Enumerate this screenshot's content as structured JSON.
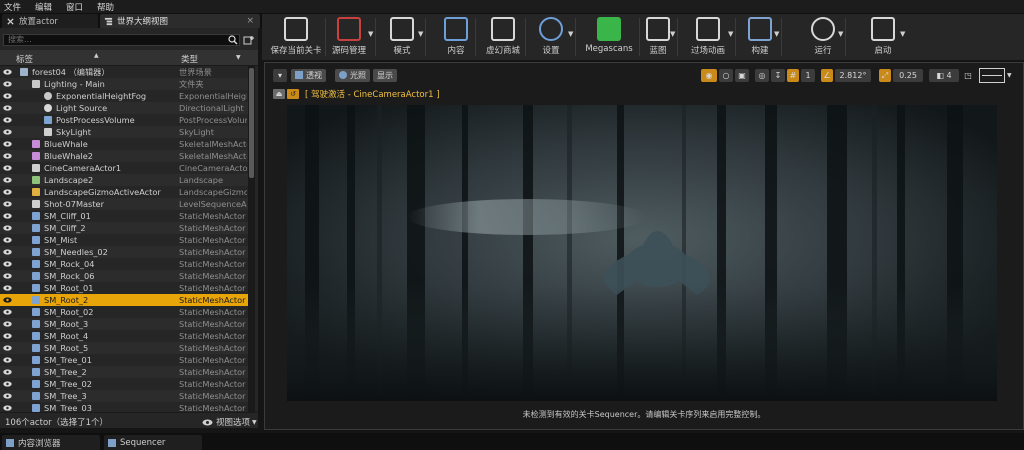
{
  "menu": [
    "文件",
    "编辑",
    "窗口",
    "帮助"
  ],
  "tabs": {
    "place_actor": "放置actor",
    "outliner": "世界大纲视图",
    "close_glyph": "×"
  },
  "outliner": {
    "search_placeholder": "搜索...",
    "col_label": "标签",
    "col_type": "类型",
    "rows": [
      {
        "label": "forest04 （编辑器）",
        "type": "世界场景",
        "icon": "world-icon"
      },
      {
        "label": "Lighting - Main",
        "type": "文件夹",
        "icon": "folder-icon"
      },
      {
        "label": "ExponentialHeightFog",
        "type": "ExponentialHeight",
        "icon": "fog-icon"
      },
      {
        "label": "Light Source",
        "type": "DirectionalLight",
        "icon": "sun-icon"
      },
      {
        "label": "PostProcessVolume",
        "type": "PostProcessVolum",
        "icon": "volume-icon"
      },
      {
        "label": "SkyLight",
        "type": "SkyLight",
        "icon": "skylight-icon"
      },
      {
        "label": "BlueWhale",
        "type": "SkeletalMeshActor",
        "icon": "skeletal-mesh-icon"
      },
      {
        "label": "BlueWhale2",
        "type": "SkeletalMeshActor",
        "icon": "skeletal-mesh-icon"
      },
      {
        "label": "CineCameraActor1",
        "type": "CineCameraActor",
        "icon": "camera-icon"
      },
      {
        "label": "Landscape2",
        "type": "Landscape",
        "icon": "landscape-icon"
      },
      {
        "label": "LandscapeGizmoActiveActor",
        "type": "LandscapeGizmoA",
        "icon": "gizmo-icon"
      },
      {
        "label": "Shot-07Master",
        "type": "LevelSequenceActo",
        "icon": "sequence-icon"
      },
      {
        "label": "SM_Cliff_01",
        "type": "StaticMeshActor",
        "icon": "static-mesh-icon"
      },
      {
        "label": "SM_Cliff_2",
        "type": "StaticMeshActor",
        "icon": "static-mesh-icon"
      },
      {
        "label": "SM_Mist",
        "type": "StaticMeshActor",
        "icon": "static-mesh-icon"
      },
      {
        "label": "SM_Needles_02",
        "type": "StaticMeshActor",
        "icon": "static-mesh-icon"
      },
      {
        "label": "SM_Rock_04",
        "type": "StaticMeshActor",
        "icon": "static-mesh-icon"
      },
      {
        "label": "SM_Rock_06",
        "type": "StaticMeshActor",
        "icon": "static-mesh-icon"
      },
      {
        "label": "SM_Root_01",
        "type": "StaticMeshActor",
        "icon": "static-mesh-icon"
      },
      {
        "label": "SM_Root_2",
        "type": "StaticMeshActor",
        "icon": "static-mesh-icon",
        "selected": true
      },
      {
        "label": "SM_Root_02",
        "type": "StaticMeshActor",
        "icon": "static-mesh-icon"
      },
      {
        "label": "SM_Root_3",
        "type": "StaticMeshActor",
        "icon": "static-mesh-icon"
      },
      {
        "label": "SM_Root_4",
        "type": "StaticMeshActor",
        "icon": "static-mesh-icon"
      },
      {
        "label": "SM_Root_5",
        "type": "StaticMeshActor",
        "icon": "static-mesh-icon"
      },
      {
        "label": "SM_Tree_01",
        "type": "StaticMeshActor",
        "icon": "static-mesh-icon"
      },
      {
        "label": "SM_Tree_2",
        "type": "StaticMeshActor",
        "icon": "static-mesh-icon"
      },
      {
        "label": "SM_Tree_02",
        "type": "StaticMeshActor",
        "icon": "static-mesh-icon"
      },
      {
        "label": "SM_Tree_3",
        "type": "StaticMeshActor",
        "icon": "static-mesh-icon"
      },
      {
        "label": "SM_Tree_03",
        "type": "StaticMeshActor",
        "icon": "static-mesh-icon"
      }
    ],
    "footer_count": "106个actor（选择了1个）",
    "view_options": "视图选项"
  },
  "toolbar": {
    "buttons": [
      {
        "label": "保存当前关卡",
        "icon": "save-icon"
      },
      {
        "label": "源码管理",
        "icon": "source-control-icon"
      },
      {
        "label": "模式",
        "icon": "modes-icon"
      },
      {
        "label": "内容",
        "icon": "content-icon"
      },
      {
        "label": "虚幻商城",
        "icon": "marketplace-icon"
      },
      {
        "label": "设置",
        "icon": "settings-icon"
      },
      {
        "label": "Megascans",
        "icon": "megascans-icon"
      },
      {
        "label": "蓝图",
        "icon": "blueprint-icon"
      },
      {
        "label": "过场动画",
        "icon": "cinematics-icon"
      },
      {
        "label": "构建",
        "icon": "build-icon"
      },
      {
        "label": "运行",
        "icon": "play-icon"
      },
      {
        "label": "启动",
        "icon": "launch-icon"
      }
    ]
  },
  "viewport": {
    "perspective": "透视",
    "lit": "光照",
    "show": "显示",
    "snap_angle": "2.812°",
    "scale_snap": "0.25",
    "grid_value": "1",
    "speed": "4",
    "pilot_text": "[ 驾驶激活 - CineCameraActor1 ]",
    "sequencer_warning": "未检测到有效的关卡Sequencer。请编辑关卡序列来启用完整控制。"
  },
  "bottom_tabs": {
    "content_browser": "内容浏览器",
    "sequencer": "Sequencer"
  },
  "colors": {
    "selection": "#e8a50a",
    "pilot_text": "#f0c040",
    "panel": "#262626"
  }
}
